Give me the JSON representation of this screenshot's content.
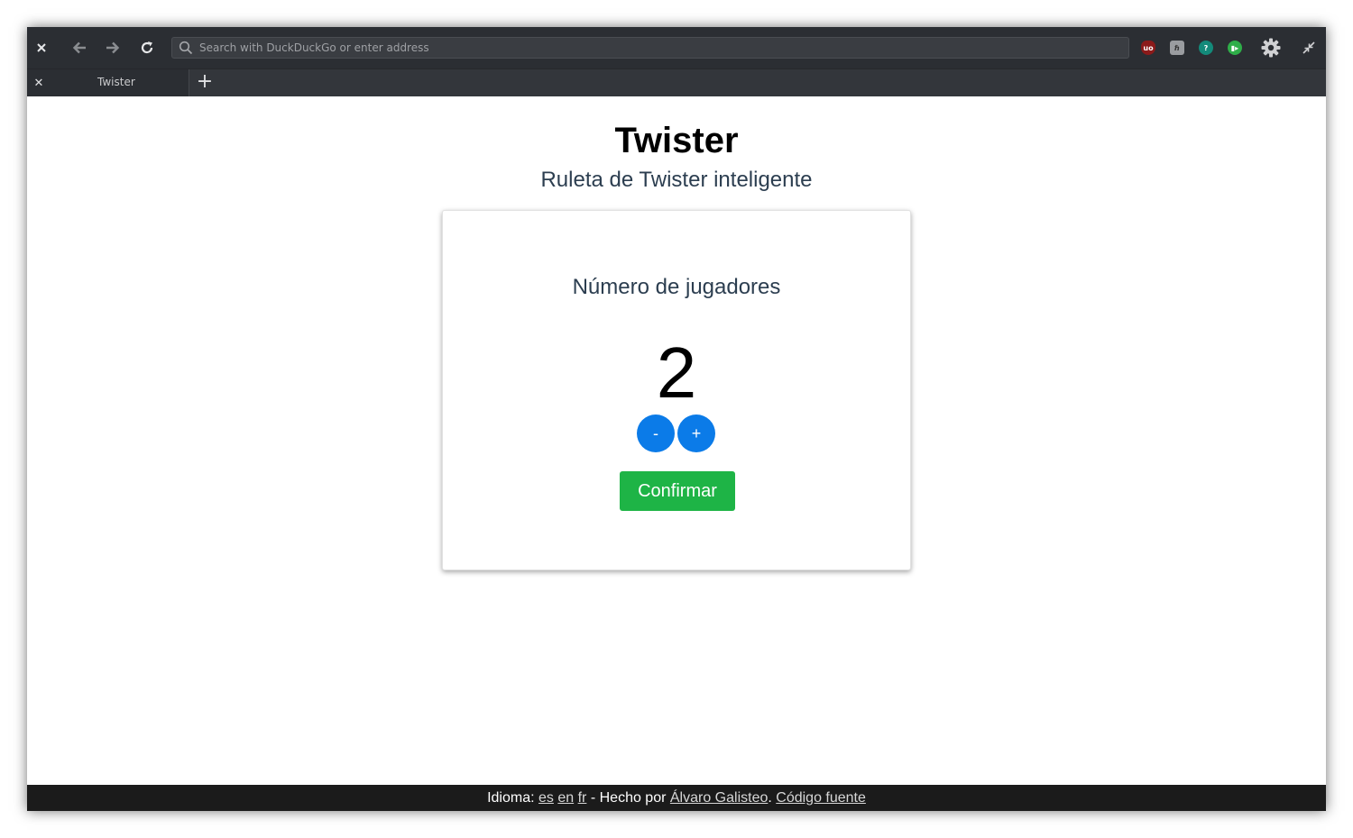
{
  "browser": {
    "url_placeholder": "Search with DuckDuckGo or enter address",
    "tab_title": "Twister",
    "close_glyph": "✕",
    "new_tab_glyph": "+"
  },
  "page": {
    "title": "Twister",
    "subtitle": "Ruleta de Twister inteligente"
  },
  "card": {
    "label": "Número de jugadores",
    "count": "2",
    "minus_label": "-",
    "plus_label": "+",
    "confirm_label": "Confirmar"
  },
  "footer": {
    "language_label": "Idioma: ",
    "lang_es": "es",
    "lang_en": "en",
    "lang_fr": "fr",
    "made_by": " - Hecho por ",
    "author": "Álvaro Galisteo",
    "separator": ". ",
    "source_code": "Código fuente"
  },
  "colors": {
    "accent_blue": "#0b7be8",
    "confirm_green": "#1eb446",
    "toolbar_bg": "#2b2e33",
    "footer_bg": "#1b1b1b"
  },
  "icons": [
    "close-icon",
    "back-arrow-icon",
    "forward-arrow-icon",
    "reload-icon",
    "search-icon",
    "ublock-icon",
    "extension-h-icon",
    "extension-help-icon",
    "extension-green-icon",
    "gear-icon",
    "exit-fullscreen-icon"
  ]
}
